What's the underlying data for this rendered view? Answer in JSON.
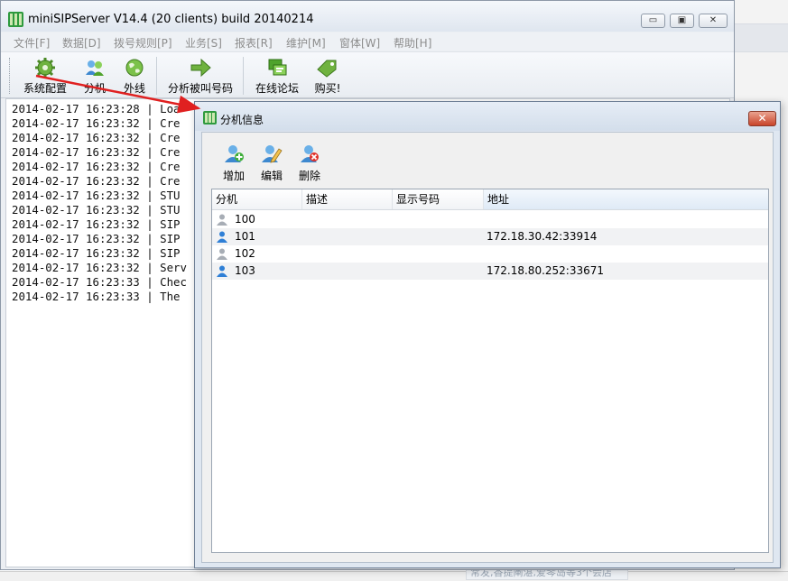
{
  "main_window": {
    "title": "miniSIPServer V14.4 (20 clients) build 20140214",
    "controls": {
      "minimize": "▭",
      "restore": "▣",
      "close": "✕"
    }
  },
  "menu": [
    {
      "label": "文件[F]"
    },
    {
      "label": "数据[D]"
    },
    {
      "label": "拨号规则[P]"
    },
    {
      "label": "业务[S]"
    },
    {
      "label": "报表[R]"
    },
    {
      "label": "维护[M]"
    },
    {
      "label": "窗体[W]"
    },
    {
      "label": "帮助[H]"
    }
  ],
  "toolbar": {
    "system_config": "系统配置",
    "extension": "分机",
    "trunk": "外线",
    "analyze_called": "分析被叫号码",
    "online_forum": "在线论坛",
    "buy": "购买!"
  },
  "log": {
    "lines": [
      {
        "time": "2014-02-17 16:23:28",
        "msg": "| Loa"
      },
      {
        "time": "2014-02-17 16:23:32",
        "msg": "| Cre"
      },
      {
        "time": "2014-02-17 16:23:32",
        "msg": "| Cre"
      },
      {
        "time": "2014-02-17 16:23:32",
        "msg": "| Cre"
      },
      {
        "time": "2014-02-17 16:23:32",
        "msg": "| Cre"
      },
      {
        "time": "2014-02-17 16:23:32",
        "msg": "| Cre"
      },
      {
        "time": "2014-02-17 16:23:32",
        "msg": "| STU"
      },
      {
        "time": "2014-02-17 16:23:32",
        "msg": "| STU"
      },
      {
        "time": "2014-02-17 16:23:32",
        "msg": "| SIP"
      },
      {
        "time": "2014-02-17 16:23:32",
        "msg": "| SIP"
      },
      {
        "time": "2014-02-17 16:23:32",
        "msg": "| SIP"
      },
      {
        "time": "2014-02-17 16:23:32",
        "msg": "| Serv"
      },
      {
        "time": "2014-02-17 16:23:33",
        "msg": "| Chec"
      },
      {
        "time": "2014-02-17 16:23:33",
        "msg": "| The"
      }
    ]
  },
  "dialog": {
    "title": "分机信息",
    "close": "✕",
    "tools": {
      "add": "增加",
      "edit": "编辑",
      "delete": "删除"
    },
    "columns": [
      "分机",
      "描述",
      "显示号码",
      "地址"
    ],
    "sort_indicator": "ˆ",
    "rows": [
      {
        "ext": "100",
        "desc": "",
        "display": "",
        "address": "",
        "online": false
      },
      {
        "ext": "101",
        "desc": "",
        "display": "",
        "address": "172.18.30.42:33914",
        "online": true
      },
      {
        "ext": "102",
        "desc": "",
        "display": "",
        "address": "",
        "online": false
      },
      {
        "ext": "103",
        "desc": "",
        "display": "",
        "address": "172.18.80.252:33671",
        "online": true
      }
    ]
  },
  "background": {
    "faded_text": "常发,香提阐湛,爱琴岛等3个会店"
  },
  "colors": {
    "arrow": "#e02020",
    "online_user": "#2f7fd6",
    "offline_user": "#a7adb5"
  }
}
